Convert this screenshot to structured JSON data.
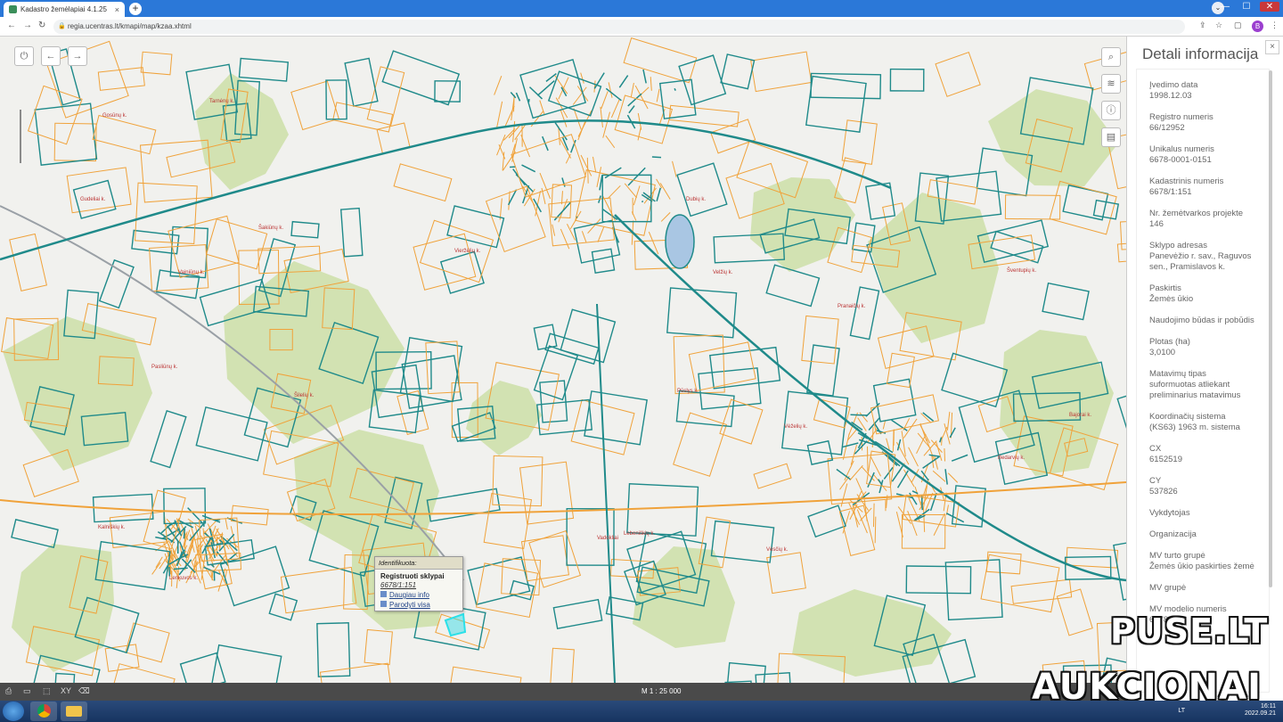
{
  "browser": {
    "tab_title": "Kadastro žemėlapiai 4.1.25",
    "tab_close": "×",
    "new_tab": "+",
    "url": "regia.ucentras.lt/kmapi/map/kzaa.xhtml",
    "profile_initial": "B",
    "win_min": "—",
    "win_max": "☐",
    "win_close": "✕"
  },
  "map": {
    "scale": "M 1 : 25 000",
    "place_labels": [
      "Gosūnų k.",
      "Tarnėnų k.",
      "Gudeliai k.",
      "Šakiūnų k.",
      "Vieržėlių k.",
      "Dubių k.",
      "Velžių k.",
      "Pranaičių k.",
      "Vėželių k.",
      "Šilelių k.",
      "Vainiūnų k.",
      "Bajorai k.",
      "Kalniškių k.",
      "Pasliūnų k.",
      "Lenkuvos k.",
      "Vadokliai",
      "Vėsčių k.",
      "Bedarvių k.",
      "Lebeniškių k.",
      "Pūslys k.",
      "Šventupių k."
    ],
    "identify": {
      "header": "Identifikuota:",
      "title": "Registruoti sklypai",
      "number": "6678/1:151",
      "more_info": "Daugiau info",
      "show_all": "Parodyti visa"
    }
  },
  "panel": {
    "title": "Detali informacija",
    "close": "×",
    "fields": [
      {
        "label": "Įvedimo data",
        "value": "1998.12.03"
      },
      {
        "label": "Registro numeris",
        "value": "66/12952"
      },
      {
        "label": "Unikalus numeris",
        "value": "6678-0001-0151"
      },
      {
        "label": "Kadastrinis numeris",
        "value": "6678/1:151"
      },
      {
        "label": "Nr. žemėtvarkos projekte",
        "value": "146"
      },
      {
        "label": "Sklypo adresas",
        "value": "Panevėžio r. sav., Raguvos sen., Pramislavos k."
      },
      {
        "label": "Paskirtis",
        "value": "Žemės ūkio"
      },
      {
        "label": "Naudojimo būdas ir pobūdis",
        "value": ""
      },
      {
        "label": "Plotas (ha)",
        "value": "3,0100"
      },
      {
        "label": "Matavimų tipas",
        "value": "suformuotas atliekant preliminarius matavimus"
      },
      {
        "label": "Koordinačių sistema",
        "value": "(KS63) 1963 m. sistema"
      },
      {
        "label": "CX",
        "value": "6152519"
      },
      {
        "label": "CY",
        "value": "537826"
      },
      {
        "label": "Vykdytojas",
        "value": ""
      },
      {
        "label": "Organizacija",
        "value": ""
      },
      {
        "label": "MV turto grupė",
        "value": "Žemės ūkio paskirties žemė"
      },
      {
        "label": "MV grupė",
        "value": ""
      },
      {
        "label": "MV modelio numeris",
        "value": "6678"
      }
    ]
  },
  "watermark": {
    "line1": "PUSE.LT",
    "line2": "AUKCIONAI"
  },
  "taskbar": {
    "lang": "LT",
    "time": "16:11",
    "date": "2022.09.21"
  },
  "colors": {
    "parcel_teal": "#1f8a8a",
    "parcel_orange": "#f0a23a",
    "forest": "#d2e2b2",
    "background": "#f1f1ee"
  }
}
